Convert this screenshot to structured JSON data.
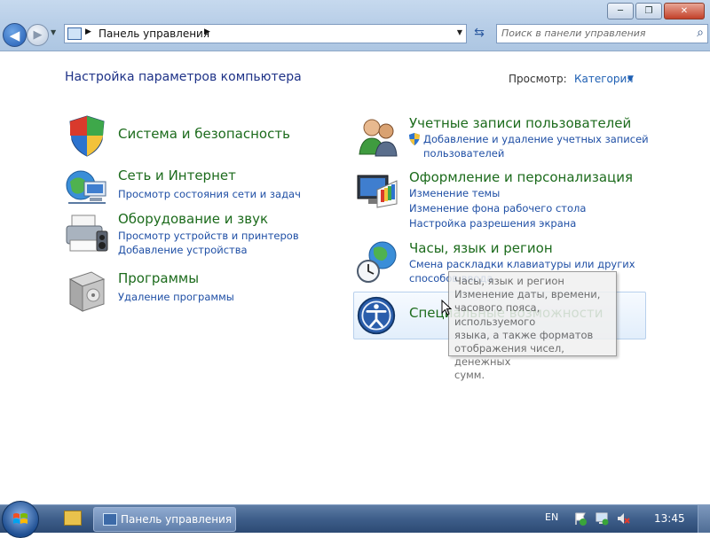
{
  "window": {
    "minimize": "─",
    "maximize": "❐",
    "close": "✕"
  },
  "nav": {
    "back": "◀",
    "forward": "▶",
    "dropdown": "▼"
  },
  "address": {
    "arrow": "▶",
    "crumb": "Панель управления",
    "dropdown": "▼"
  },
  "refresh": "⇆",
  "search": {
    "placeholder": "Поиск в панели управления",
    "icon": "⌕"
  },
  "header": {
    "title": "Настройка параметров компьютера",
    "view_label": "Просмотр:",
    "view_value": "Категория",
    "view_chevron": "▼"
  },
  "categories": {
    "system": {
      "title": "Система и безопасность",
      "icon": "shield-icon"
    },
    "network": {
      "title": "Сеть и Интернет",
      "links": [
        "Просмотр состояния сети и задач"
      ],
      "icon": "network-globe-icon"
    },
    "hardware": {
      "title": "Оборудование и звук",
      "links": [
        "Просмотр устройств и принтеров",
        "Добавление устройства"
      ],
      "icon": "printer-icon"
    },
    "programs": {
      "title": "Программы",
      "links": [
        "Удаление программы"
      ],
      "icon": "programs-box-icon"
    },
    "accounts": {
      "title": "Учетные записи пользователей",
      "links": [
        "Добавление и удаление учетных записей",
        "пользователей"
      ],
      "icon": "users-icon"
    },
    "appearance": {
      "title": "Оформление и персонализация",
      "links": [
        "Изменение темы",
        "Изменение фона рабочего стола",
        "Настройка разрешения экрана"
      ],
      "icon": "monitor-palette-icon"
    },
    "clock": {
      "title": "Часы, язык и регион",
      "links": [
        "Смена раскладки клавиатуры или других",
        "способов ввода"
      ],
      "icon": "clock-globe-icon"
    },
    "access": {
      "title": "Специальные возможности",
      "icon": "accessibility-icon"
    }
  },
  "tooltip": {
    "lines": [
      "Часы, язык и регион",
      "Изменение даты, времени,",
      "часового пояса, используемого",
      "языка, а также форматов",
      "отображения чисел, денежных",
      "сумм."
    ]
  },
  "taskbar": {
    "task_label": "Панель управления",
    "language": "EN",
    "clock": "13:45"
  },
  "colors": {
    "category_title": "#1c6b1c",
    "link": "#1f4fa5",
    "page_title": "#1e3287"
  }
}
